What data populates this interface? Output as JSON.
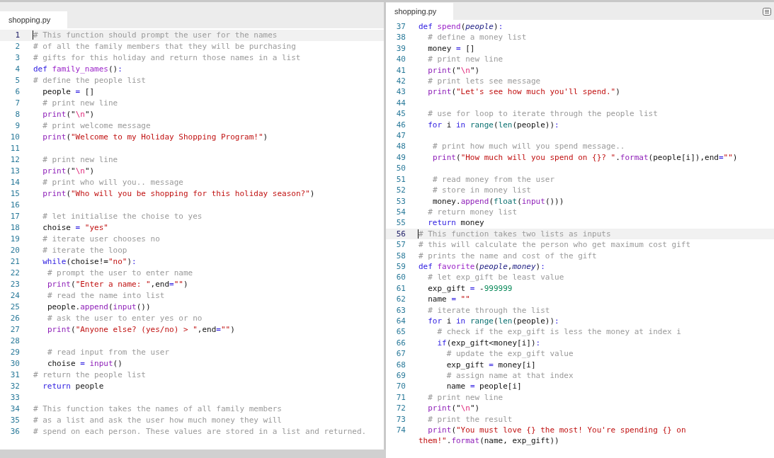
{
  "panes": [
    {
      "tab": "shopping.py",
      "lines": [
        {
          "number": "1",
          "selected": true,
          "tokens": [
            {
              "kind": "comment",
              "text": "# This function should prompt the user for the names"
            }
          ]
        },
        {
          "number": "2",
          "selected": false,
          "tokens": [
            {
              "kind": "comment",
              "text": "# of all the family members that they will be purchasing"
            }
          ]
        },
        {
          "number": "3",
          "selected": false,
          "tokens": [
            {
              "kind": "comment",
              "text": "# gifts for this holiday and return those names in a list"
            }
          ]
        },
        {
          "number": "4",
          "selected": false,
          "tokens": [
            {
              "kind": "keyword",
              "text": "def "
            },
            {
              "kind": "func",
              "text": "family_names"
            },
            {
              "kind": "plain",
              "text": "()"
            },
            {
              "kind": "op",
              "text": ":"
            }
          ]
        },
        {
          "number": "5",
          "selected": false,
          "tokens": [
            {
              "kind": "comment",
              "text": "# define the people list"
            }
          ]
        },
        {
          "number": "6",
          "selected": false,
          "tokens": [
            {
              "kind": "plain",
              "text": "  people "
            },
            {
              "kind": "op",
              "text": "="
            },
            {
              "kind": "plain",
              "text": " []"
            }
          ]
        },
        {
          "number": "7",
          "selected": false,
          "tokens": [
            {
              "kind": "comment",
              "text": "  # print new line"
            }
          ]
        },
        {
          "number": "8",
          "selected": false,
          "tokens": [
            {
              "kind": "call",
              "text": "  print"
            },
            {
              "kind": "plain",
              "text": "(\""
            },
            {
              "kind": "escape",
              "text": "\\n"
            },
            {
              "kind": "plain",
              "text": "\")"
            }
          ]
        },
        {
          "number": "9",
          "selected": false,
          "tokens": [
            {
              "kind": "comment",
              "text": "  # print welcome message"
            }
          ]
        },
        {
          "number": "10",
          "selected": false,
          "tokens": [
            {
              "kind": "call",
              "text": "  print"
            },
            {
              "kind": "plain",
              "text": "("
            },
            {
              "kind": "string",
              "text": "\"Welcome to my Holiday Shopping Program!\""
            },
            {
              "kind": "plain",
              "text": ")"
            }
          ]
        },
        {
          "number": "11",
          "selected": false
        },
        {
          "number": "12",
          "selected": false,
          "tokens": [
            {
              "kind": "comment",
              "text": "  # print new line"
            }
          ]
        },
        {
          "number": "13",
          "selected": false,
          "tokens": [
            {
              "kind": "call",
              "text": "  print"
            },
            {
              "kind": "plain",
              "text": "(\""
            },
            {
              "kind": "escape",
              "text": "\\n"
            },
            {
              "kind": "plain",
              "text": "\")"
            }
          ]
        },
        {
          "number": "14",
          "selected": false,
          "tokens": [
            {
              "kind": "comment",
              "text": "  # print who will you.. message"
            }
          ]
        },
        {
          "number": "15",
          "selected": false,
          "tokens": [
            {
              "kind": "call",
              "text": "  print"
            },
            {
              "kind": "plain",
              "text": "("
            },
            {
              "kind": "string",
              "text": "\"Who will you be shopping for this holiday season?\""
            },
            {
              "kind": "plain",
              "text": ")"
            }
          ]
        },
        {
          "number": "16",
          "selected": false
        },
        {
          "number": "17",
          "selected": false,
          "tokens": [
            {
              "kind": "comment",
              "text": "  # let initialise the choise to yes"
            }
          ]
        },
        {
          "number": "18",
          "selected": false,
          "tokens": [
            {
              "kind": "plain",
              "text": "  choise "
            },
            {
              "kind": "op",
              "text": "="
            },
            {
              "kind": "string",
              "text": " \"yes\""
            }
          ]
        },
        {
          "number": "19",
          "selected": false,
          "tokens": [
            {
              "kind": "comment",
              "text": "  # iterate user chooses no"
            }
          ]
        },
        {
          "number": "20",
          "selected": false,
          "tokens": [
            {
              "kind": "comment",
              "text": "  # iterate the loop"
            }
          ]
        },
        {
          "number": "21",
          "selected": false,
          "tokens": [
            {
              "kind": "keyword",
              "text": "  while"
            },
            {
              "kind": "plain",
              "text": "(choise!="
            },
            {
              "kind": "string",
              "text": "\"no\""
            },
            {
              "kind": "plain",
              "text": ")"
            },
            {
              "kind": "op",
              "text": ":"
            }
          ]
        },
        {
          "number": "22",
          "selected": false,
          "tokens": [
            {
              "kind": "comment",
              "text": "   # prompt the user to enter name"
            }
          ]
        },
        {
          "number": "23",
          "selected": false,
          "tokens": [
            {
              "kind": "call",
              "text": "   print"
            },
            {
              "kind": "plain",
              "text": "("
            },
            {
              "kind": "string",
              "text": "\"Enter a name: \""
            },
            {
              "kind": "plain",
              "text": ",end"
            },
            {
              "kind": "op",
              "text": "="
            },
            {
              "kind": "string",
              "text": "\"\""
            },
            {
              "kind": "plain",
              "text": ")"
            }
          ]
        },
        {
          "number": "24",
          "selected": false,
          "tokens": [
            {
              "kind": "comment",
              "text": "   # read the name into list"
            }
          ]
        },
        {
          "number": "25",
          "selected": false,
          "tokens": [
            {
              "kind": "plain",
              "text": "   people."
            },
            {
              "kind": "call",
              "text": "append"
            },
            {
              "kind": "plain",
              "text": "("
            },
            {
              "kind": "call",
              "text": "input"
            },
            {
              "kind": "plain",
              "text": "())"
            }
          ]
        },
        {
          "number": "26",
          "selected": false,
          "tokens": [
            {
              "kind": "comment",
              "text": "   # ask the user to enter yes or no"
            }
          ]
        },
        {
          "number": "27",
          "selected": false,
          "tokens": [
            {
              "kind": "call",
              "text": "   print"
            },
            {
              "kind": "plain",
              "text": "("
            },
            {
              "kind": "string",
              "text": "\"Anyone else? (yes/no) > \""
            },
            {
              "kind": "plain",
              "text": ",end"
            },
            {
              "kind": "op",
              "text": "="
            },
            {
              "kind": "string",
              "text": "\"\""
            },
            {
              "kind": "plain",
              "text": ")"
            }
          ]
        },
        {
          "number": "28",
          "selected": false
        },
        {
          "number": "29",
          "selected": false,
          "tokens": [
            {
              "kind": "comment",
              "text": "   # read input from the user"
            }
          ]
        },
        {
          "number": "30",
          "selected": false,
          "tokens": [
            {
              "kind": "plain",
              "text": "   choise "
            },
            {
              "kind": "op",
              "text": "="
            },
            {
              "kind": "call",
              "text": " input"
            },
            {
              "kind": "plain",
              "text": "()"
            }
          ]
        },
        {
          "number": "31",
          "selected": false,
          "tokens": [
            {
              "kind": "comment",
              "text": "# return the people list"
            }
          ]
        },
        {
          "number": "32",
          "selected": false,
          "tokens": [
            {
              "kind": "keyword",
              "text": "  return"
            },
            {
              "kind": "plain",
              "text": " people"
            }
          ]
        },
        {
          "number": "33",
          "selected": false
        },
        {
          "number": "34",
          "selected": false,
          "tokens": [
            {
              "kind": "comment",
              "text": "# This function takes the names of all family members"
            }
          ]
        },
        {
          "number": "35",
          "selected": false,
          "tokens": [
            {
              "kind": "comment",
              "text": "# as a list and ask the user how much money they will"
            }
          ]
        },
        {
          "number": "36",
          "selected": false,
          "tokens": [
            {
              "kind": "comment",
              "text": "# spend on each person. These values are stored in a list and returned."
            }
          ]
        }
      ]
    },
    {
      "tab": "shopping.py",
      "lines": [
        {
          "number": "37",
          "selected": false,
          "tokens": [
            {
              "kind": "keyword",
              "text": "def "
            },
            {
              "kind": "func",
              "text": "spend"
            },
            {
              "kind": "plain",
              "text": "("
            },
            {
              "kind": "param",
              "text": "people"
            },
            {
              "kind": "plain",
              "text": ")"
            },
            {
              "kind": "op",
              "text": ":"
            }
          ]
        },
        {
          "number": "38",
          "selected": false,
          "tokens": [
            {
              "kind": "comment",
              "text": "  # define a money list"
            }
          ]
        },
        {
          "number": "39",
          "selected": false,
          "tokens": [
            {
              "kind": "plain",
              "text": "  money "
            },
            {
              "kind": "op",
              "text": "="
            },
            {
              "kind": "plain",
              "text": " []"
            }
          ]
        },
        {
          "number": "40",
          "selected": false,
          "tokens": [
            {
              "kind": "comment",
              "text": "  # print new line"
            }
          ]
        },
        {
          "number": "41",
          "selected": false,
          "tokens": [
            {
              "kind": "call",
              "text": "  print"
            },
            {
              "kind": "plain",
              "text": "(\""
            },
            {
              "kind": "escape",
              "text": "\\n"
            },
            {
              "kind": "plain",
              "text": "\")"
            }
          ]
        },
        {
          "number": "42",
          "selected": false,
          "tokens": [
            {
              "kind": "comment",
              "text": "  # print lets see message"
            }
          ]
        },
        {
          "number": "43",
          "selected": false,
          "tokens": [
            {
              "kind": "call",
              "text": "  print"
            },
            {
              "kind": "plain",
              "text": "("
            },
            {
              "kind": "string",
              "text": "\"Let's see how much you'll spend.\""
            },
            {
              "kind": "plain",
              "text": ")"
            }
          ]
        },
        {
          "number": "44",
          "selected": false
        },
        {
          "number": "45",
          "selected": false,
          "tokens": [
            {
              "kind": "comment",
              "text": "  # use for loop to iterate through the people list"
            }
          ]
        },
        {
          "number": "46",
          "selected": false,
          "tokens": [
            {
              "kind": "keyword",
              "text": "  for"
            },
            {
              "kind": "plain",
              "text": " i "
            },
            {
              "kind": "keyword",
              "text": "in "
            },
            {
              "kind": "builtin",
              "text": "range"
            },
            {
              "kind": "plain",
              "text": "("
            },
            {
              "kind": "builtin",
              "text": "len"
            },
            {
              "kind": "plain",
              "text": "(people))"
            },
            {
              "kind": "op",
              "text": ":"
            }
          ]
        },
        {
          "number": "47",
          "selected": false
        },
        {
          "number": "48",
          "selected": false,
          "tokens": [
            {
              "kind": "comment",
              "text": "   # print how much will you spend message.."
            }
          ]
        },
        {
          "number": "49",
          "selected": false,
          "tokens": [
            {
              "kind": "call",
              "text": "   print"
            },
            {
              "kind": "plain",
              "text": "("
            },
            {
              "kind": "string",
              "text": "\"How much will you spend on {}? \""
            },
            {
              "kind": "plain",
              "text": "."
            },
            {
              "kind": "call",
              "text": "format"
            },
            {
              "kind": "plain",
              "text": "(people[i]),end"
            },
            {
              "kind": "op",
              "text": "="
            },
            {
              "kind": "string",
              "text": "\"\""
            },
            {
              "kind": "plain",
              "text": ")"
            }
          ]
        },
        {
          "number": "50",
          "selected": false
        },
        {
          "number": "51",
          "selected": false,
          "tokens": [
            {
              "kind": "comment",
              "text": "   # read money from the user"
            }
          ]
        },
        {
          "number": "52",
          "selected": false,
          "tokens": [
            {
              "kind": "comment",
              "text": "   # store in money list"
            }
          ]
        },
        {
          "number": "53",
          "selected": false,
          "tokens": [
            {
              "kind": "plain",
              "text": "   money."
            },
            {
              "kind": "call",
              "text": "append"
            },
            {
              "kind": "plain",
              "text": "("
            },
            {
              "kind": "builtin",
              "text": "float"
            },
            {
              "kind": "plain",
              "text": "("
            },
            {
              "kind": "call",
              "text": "input"
            },
            {
              "kind": "plain",
              "text": "()))"
            }
          ]
        },
        {
          "number": "54",
          "selected": false,
          "tokens": [
            {
              "kind": "comment",
              "text": "  # return money list"
            }
          ]
        },
        {
          "number": "55",
          "selected": false,
          "tokens": [
            {
              "kind": "keyword",
              "text": "  return"
            },
            {
              "kind": "plain",
              "text": " money"
            }
          ]
        },
        {
          "number": "56",
          "selected": true,
          "tokens": [
            {
              "kind": "comment",
              "text": "# This function takes two lists as inputs"
            }
          ]
        },
        {
          "number": "57",
          "selected": false,
          "tokens": [
            {
              "kind": "comment",
              "text": "# this will calculate the person who get maximum cost gift"
            }
          ]
        },
        {
          "number": "58",
          "selected": false,
          "tokens": [
            {
              "kind": "comment",
              "text": "# prints the name and cost of the gift"
            }
          ]
        },
        {
          "number": "59",
          "selected": false,
          "tokens": [
            {
              "kind": "keyword",
              "text": "def "
            },
            {
              "kind": "func",
              "text": "favorite"
            },
            {
              "kind": "plain",
              "text": "("
            },
            {
              "kind": "param",
              "text": "people"
            },
            {
              "kind": "plain",
              "text": ","
            },
            {
              "kind": "param",
              "text": "money"
            },
            {
              "kind": "plain",
              "text": ")"
            },
            {
              "kind": "op",
              "text": ":"
            }
          ]
        },
        {
          "number": "60",
          "selected": false,
          "tokens": [
            {
              "kind": "comment",
              "text": "  # let exp_gift be least value"
            }
          ]
        },
        {
          "number": "61",
          "selected": false,
          "tokens": [
            {
              "kind": "plain",
              "text": "  exp_gift "
            },
            {
              "kind": "op",
              "text": "="
            },
            {
              "kind": "plain",
              "text": " -"
            },
            {
              "kind": "number",
              "text": "999999"
            }
          ]
        },
        {
          "number": "62",
          "selected": false,
          "tokens": [
            {
              "kind": "plain",
              "text": "  name "
            },
            {
              "kind": "op",
              "text": "="
            },
            {
              "kind": "string",
              "text": " \"\""
            }
          ]
        },
        {
          "number": "63",
          "selected": false,
          "tokens": [
            {
              "kind": "comment",
              "text": "  # iterate through the list"
            }
          ]
        },
        {
          "number": "64",
          "selected": false,
          "tokens": [
            {
              "kind": "keyword",
              "text": "  for"
            },
            {
              "kind": "plain",
              "text": " i "
            },
            {
              "kind": "keyword",
              "text": "in "
            },
            {
              "kind": "builtin",
              "text": "range"
            },
            {
              "kind": "plain",
              "text": "("
            },
            {
              "kind": "builtin",
              "text": "len"
            },
            {
              "kind": "plain",
              "text": "(people))"
            },
            {
              "kind": "op",
              "text": ":"
            }
          ]
        },
        {
          "number": "65",
          "selected": false,
          "tokens": [
            {
              "kind": "comment",
              "text": "    # check if the exp_gift is less the money at index i"
            }
          ]
        },
        {
          "number": "66",
          "selected": false,
          "tokens": [
            {
              "kind": "keyword",
              "text": "    if"
            },
            {
              "kind": "plain",
              "text": "(exp_gift<money[i])"
            },
            {
              "kind": "op",
              "text": ":"
            }
          ]
        },
        {
          "number": "67",
          "selected": false,
          "tokens": [
            {
              "kind": "comment",
              "text": "      # update the exp_gift value"
            }
          ]
        },
        {
          "number": "68",
          "selected": false,
          "tokens": [
            {
              "kind": "plain",
              "text": "      exp_gift "
            },
            {
              "kind": "op",
              "text": "="
            },
            {
              "kind": "plain",
              "text": " money[i]"
            }
          ]
        },
        {
          "number": "69",
          "selected": false,
          "tokens": [
            {
              "kind": "comment",
              "text": "      # assign name at that index"
            }
          ]
        },
        {
          "number": "70",
          "selected": false,
          "tokens": [
            {
              "kind": "plain",
              "text": "      name "
            },
            {
              "kind": "op",
              "text": "="
            },
            {
              "kind": "plain",
              "text": " people[i]"
            }
          ]
        },
        {
          "number": "71",
          "selected": false,
          "tokens": [
            {
              "kind": "comment",
              "text": "  # print new line"
            }
          ]
        },
        {
          "number": "72",
          "selected": false,
          "tokens": [
            {
              "kind": "call",
              "text": "  print"
            },
            {
              "kind": "plain",
              "text": "(\""
            },
            {
              "kind": "escape",
              "text": "\\n"
            },
            {
              "kind": "plain",
              "text": "\")"
            }
          ]
        },
        {
          "number": "73",
          "selected": false,
          "tokens": [
            {
              "kind": "comment",
              "text": "  # print the result"
            }
          ]
        },
        {
          "number": "74",
          "selected": false,
          "tokens": [
            {
              "kind": "call",
              "text": "  print"
            },
            {
              "kind": "plain",
              "text": "("
            },
            {
              "kind": "string",
              "text": "\"You must love {} the most! You're spending {} on them!\""
            },
            {
              "kind": "plain",
              "text": "."
            },
            {
              "kind": "call",
              "text": "format"
            },
            {
              "kind": "plain",
              "text": "(name, exp_gift))"
            }
          ]
        }
      ]
    }
  ]
}
